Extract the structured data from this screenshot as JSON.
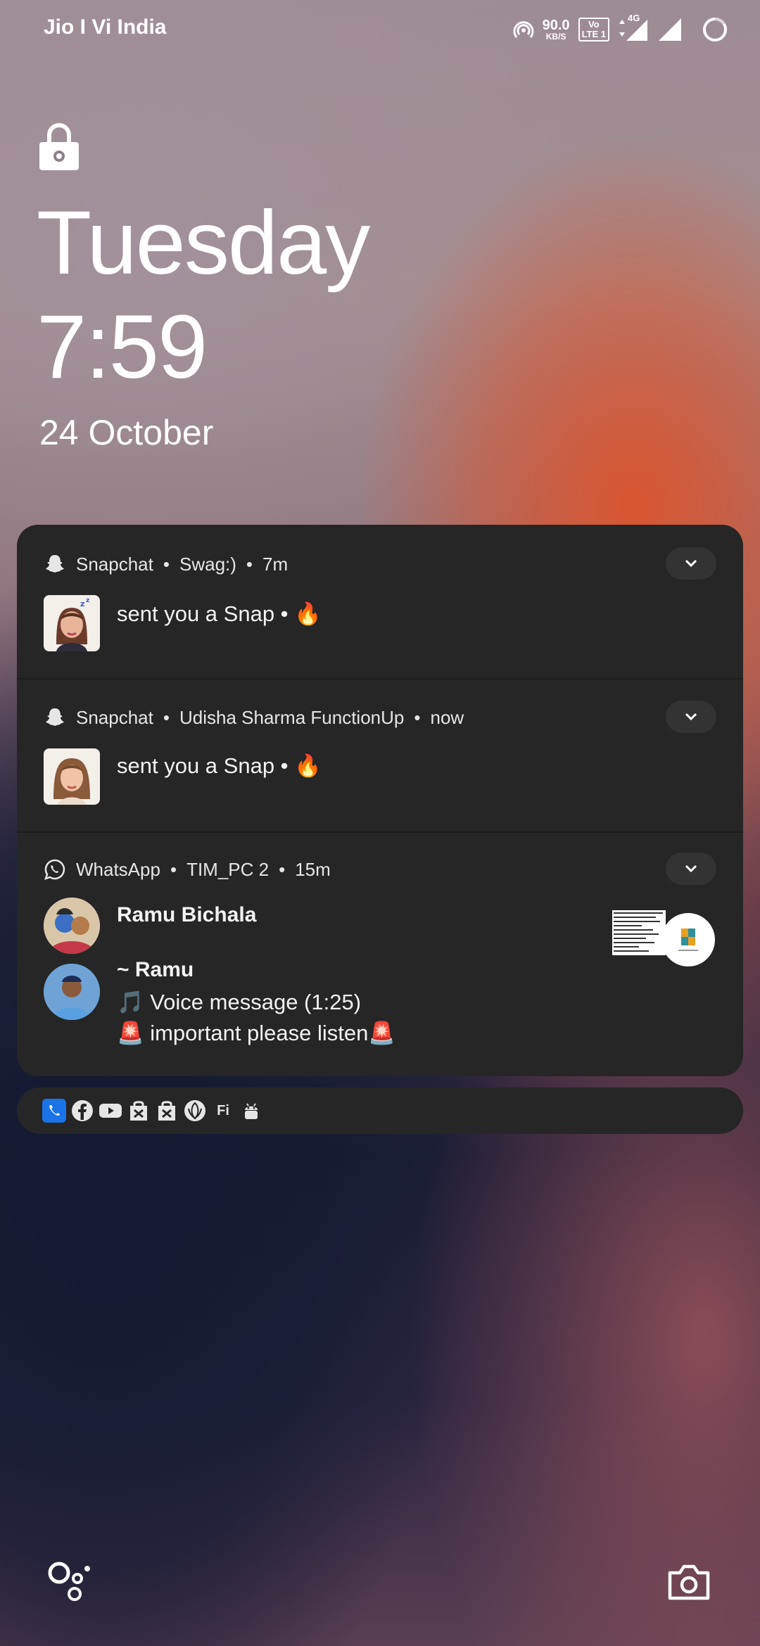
{
  "status_bar": {
    "carrier": "Jio I Vi India",
    "net_speed_value": "90.0",
    "net_speed_unit": "KB/S",
    "volte_top": "Vo",
    "volte_bottom": "LTE 1",
    "network_type": "4G"
  },
  "lockscreen": {
    "day": "Tuesday",
    "time": "7:59",
    "date": "24 October"
  },
  "notifications": [
    {
      "app": "Snapchat",
      "separator_1": "•",
      "sender": "Swag:)",
      "separator_2": "•",
      "time": "7m",
      "message": "sent you a Snap • 🔥",
      "app_icon": "ghost-icon"
    },
    {
      "app": "Snapchat",
      "separator_1": "•",
      "sender": "Udisha Sharma FunctionUp",
      "separator_2": "•",
      "time": "now",
      "message": "sent you a Snap • 🔥",
      "app_icon": "ghost-icon"
    },
    {
      "app": "WhatsApp",
      "separator_1": "•",
      "sender": "TIM_PC 2",
      "separator_2": "•",
      "time": "15m",
      "app_icon": "whatsapp-icon",
      "messages": [
        {
          "name": "Ramu Bichala"
        },
        {
          "name": "~ Ramu",
          "line1": "🎵 Voice message (1:25)",
          "line2": "🚨 important please listen🚨"
        }
      ]
    }
  ],
  "mini_icons": [
    "phone-icon",
    "facebook-icon",
    "youtube-icon",
    "bag-icon",
    "bag-icon",
    "leaf-icon",
    "fi-icon",
    "android-icon"
  ],
  "mini_fi_label": "Fi",
  "colors": {
    "panel_bg": "#262626",
    "phone_blue": "#1a73e8"
  }
}
